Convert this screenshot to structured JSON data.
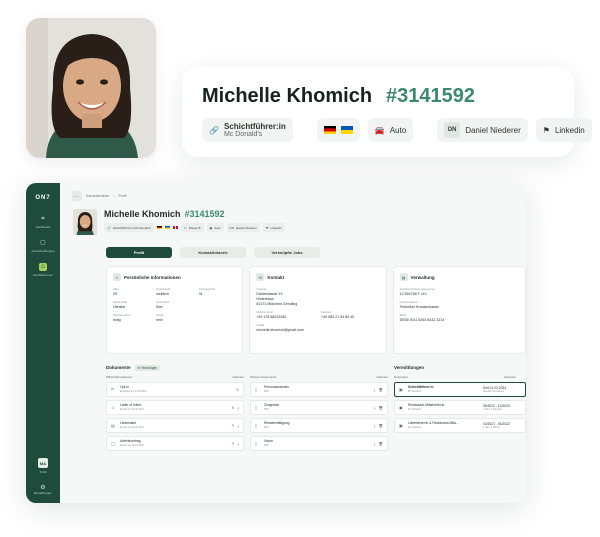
{
  "hero": {
    "name": "Michelle Khomich",
    "id": "#3141592",
    "role_title": "Schichtführer:in",
    "role_company": "Mc Donald's",
    "car": "Auto",
    "contact_initials": "DN",
    "contact_name": "Daniel Niederer",
    "linkedin": "Linkedin"
  },
  "app": {
    "logo": "ON7",
    "nav": [
      "Dashboard",
      "Ausschreibungen",
      "Kandidat:innen"
    ],
    "user_initials": "MA",
    "user_label": "Profil",
    "settings_label": "Einstellungen",
    "breadcrumb": [
      "Kandidat:innen",
      "Profil"
    ],
    "head": {
      "name": "Michelle Khomich",
      "id": "#3141592",
      "chips": [
        "Schichtführer:in Mc Donald's",
        "Klasse B",
        "Auto",
        "Daniel Niederer",
        "Linkedin"
      ]
    },
    "tabs": [
      "Profil",
      "Kontakthistorie",
      "Verknüpfte Jobs"
    ],
    "personal": {
      "title": "Persönliche Informationen",
      "fields": [
        {
          "label": "Alter",
          "value": "25"
        },
        {
          "label": "Geschlecht",
          "value": "weiblich"
        },
        {
          "label": "Erfolgsgröße",
          "value": "M"
        },
        {
          "label": "Nationalität",
          "value": "Ukraine"
        },
        {
          "label": "Geburtsort",
          "value": "Kiev"
        },
        {
          "label": "",
          "value": ""
        },
        {
          "label": "Familienstand",
          "value": "ledig"
        },
        {
          "label": "Kinder",
          "value": "nein"
        },
        {
          "label": "",
          "value": ""
        }
      ]
    },
    "contact": {
      "title": "Kontakt",
      "address_label": "Adresse",
      "address": [
        "Dantestrasse 19",
        "Hinterhaus",
        "81371 München-Sendling"
      ],
      "mobile_label": "Mobilnummer",
      "mobile": "+49 178 88223340",
      "festnetz_label": "Festnetz",
      "festnetz": "+49 089 21 54 89 40",
      "email_label": "E-Mail",
      "email": "michelle.khomich@gmail.com"
    },
    "admin": {
      "title": "Verwaltung",
      "f1_label": "Sozialversicherungsnummer",
      "f1": "12 554768 F 110",
      "f2_label": "Krankenkasse",
      "f2": "Techniker Krankenkasse",
      "f3_label": "IBAN",
      "f3": "DE55 0011 6353 8432 3214"
    },
    "docs": {
      "title": "Dokumente",
      "add": "Hinzufügen",
      "col1": "Pflichtinformationen",
      "col1b": "Aktionen",
      "col2": "Weitere Dokumente",
      "col2b": "Aktionen",
      "left": [
        {
          "name": "Opt-in",
          "sub": "Eingefügt am 23.03.2021"
        },
        {
          "name": "Letter of Intent",
          "sub": "Erstellt am 01.06.2021"
        },
        {
          "name": "Lebenslauf",
          "sub": "Erstellt am 01.06.2021"
        },
        {
          "name": "Arbeitsvertrag",
          "sub": "Erstellt am 02.11.2022"
        }
      ],
      "right": [
        {
          "name": "Personalausweis",
          "sub": "PDF"
        },
        {
          "name": "Zeugnisse",
          "sub": "PDF"
        },
        {
          "name": "Reisebestätigung",
          "sub": "PDF"
        },
        {
          "name": "Visum",
          "sub": "PDF"
        }
      ]
    },
    "placements": {
      "title": "Vermittlungen",
      "col1": "Dokument",
      "col2": "Zeitraum",
      "rows": [
        {
          "name": "Schichtführer:in",
          "sub": "Mc Donald's",
          "range": "Seit 01.02.2024",
          "rsub": "Aktuelle Vermittlung"
        },
        {
          "name": "Restaurant-Mitarbeiter:in",
          "sub": "Mc Donald's",
          "range": "05/2022 - 12/2023",
          "rsub": "1 Jahr, 7 Monaten"
        },
        {
          "name": "Lieferfahrer:in & Restaurant-Mita...",
          "sub": "Mc Donald's",
          "range": "03/2021 - 04/2022",
          "rsub": "1 Jahr, 1 Monat"
        }
      ]
    }
  }
}
